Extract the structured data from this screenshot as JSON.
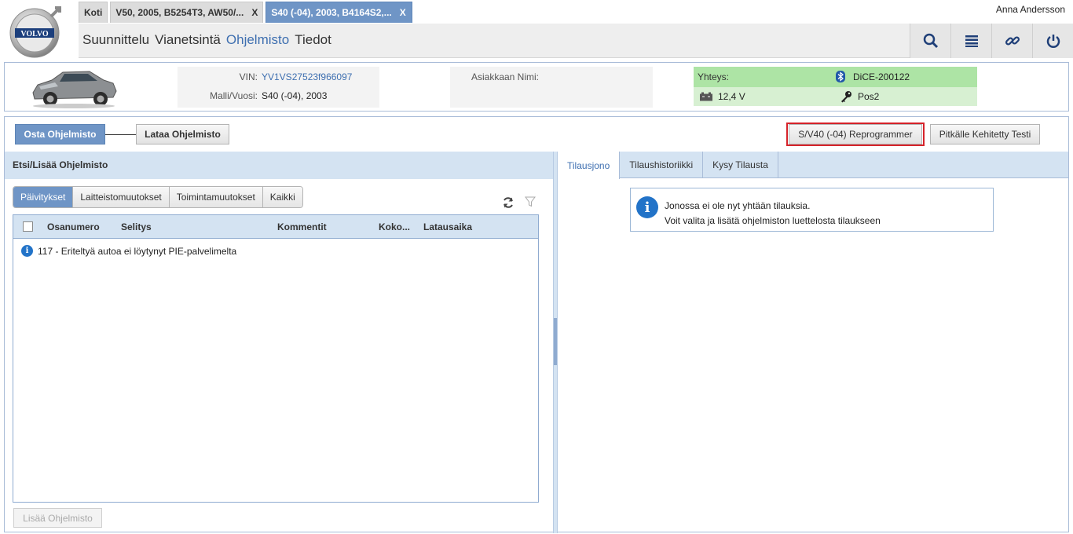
{
  "app": {
    "user": "Anna Andersson",
    "logo_text": "VOLVO"
  },
  "tabs": [
    {
      "label": "Koti"
    },
    {
      "label": "V50, 2005, B5254T3, AW50/...",
      "close": "X"
    },
    {
      "label": "S40 (-04), 2003, B4164S2,...",
      "close": "X"
    }
  ],
  "nav": [
    "Suunnittelu",
    "Vianetsintä",
    "Ohjelmisto",
    "Tiedot"
  ],
  "nav_selected": "Ohjelmisto",
  "toolbar_icons": [
    "search-icon",
    "list-icon",
    "link-icon",
    "power-icon"
  ],
  "vehicle": {
    "vin_label": "VIN:",
    "vin": "YV1VS27523f966097",
    "model_label": "Malli/Vuosi:",
    "model": "S40 (-04), 2003",
    "customer_label": "Asiakkaan Nimi:",
    "customer": ""
  },
  "connection": {
    "label": "Yhteys:",
    "device": "DiCE-200122",
    "voltage": "12,4 V",
    "ignition": "Pos2",
    "color_top": "#ade4a5",
    "color_bottom": "#d7f0d2"
  },
  "actions": {
    "buy": "Osta Ohjelmisto",
    "download": "Lataa Ohjelmisto",
    "reprogrammer": "S/V40 (-04) Reprogrammer",
    "extended_test": "Pitkälle Kehitetty Testi"
  },
  "left": {
    "title": "Etsi/Lisää Ohjelmisto",
    "subtabs": [
      "Päivitykset",
      "Laitteistomuutokset",
      "Toimintamuutokset",
      "Kaikki"
    ],
    "columns": [
      "Osanumero",
      "Selitys",
      "Kommentit",
      "Koko...",
      "Latausaika"
    ],
    "message": "117 - Eriteltyä autoa ei löytynyt PIE-palvelimelta",
    "add_button": "Lisää Ohjelmisto"
  },
  "right": {
    "tabs": [
      "Tilausjono",
      "Tilaushistoriikki",
      "Kysy Tilausta"
    ],
    "notice_line1": "Jonossa ei ole nyt yhtään tilauksia.",
    "notice_line2": "Voit valita ja lisätä ohjelmiston luettelosta tilaukseen"
  }
}
